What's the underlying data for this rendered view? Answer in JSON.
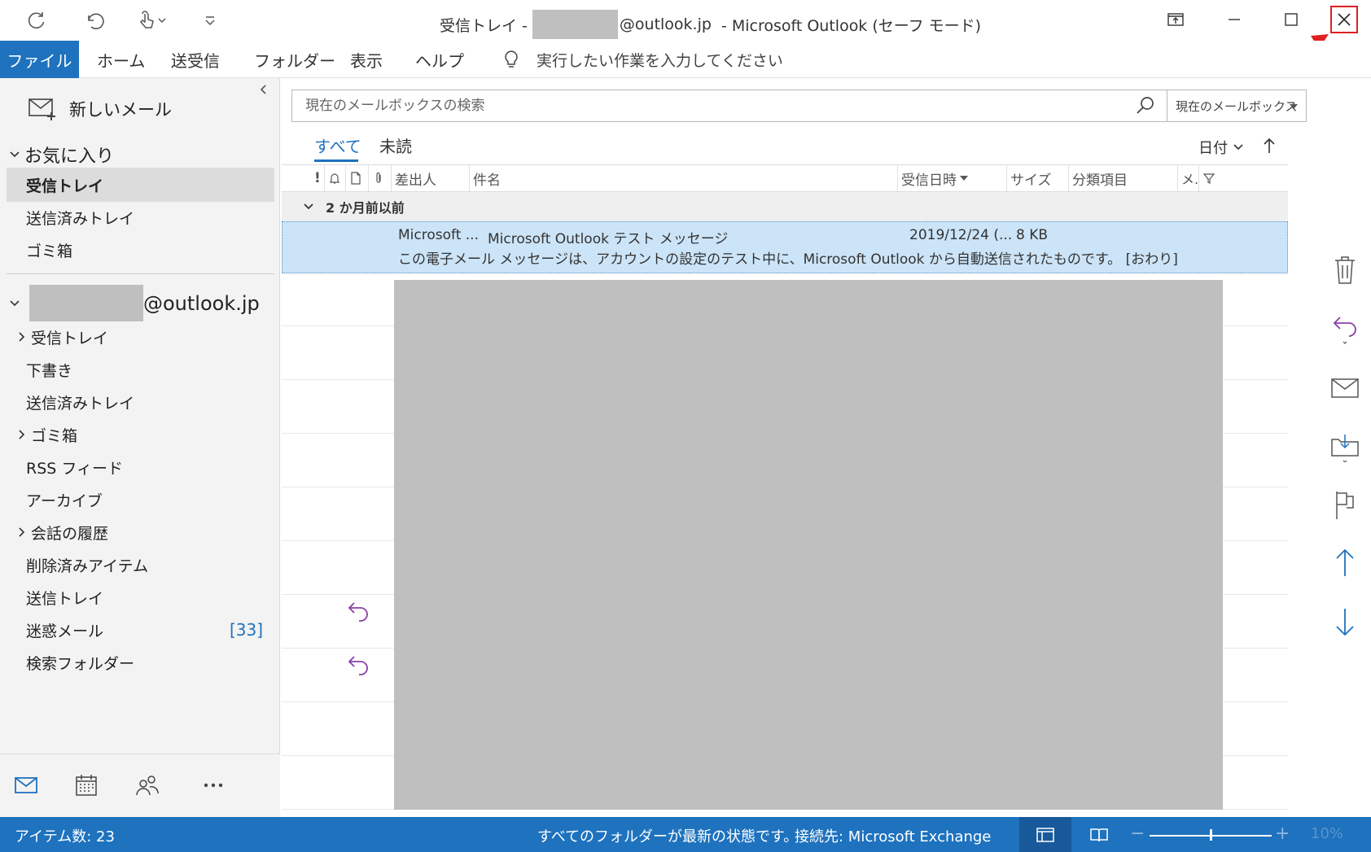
{
  "titlebar": {
    "title_prefix": "受信トレイ -",
    "title_domain": "@outlook.jp",
    "title_app": "-  Microsoft Outlook (セーフ モード)"
  },
  "ribbon": {
    "tabs": [
      "ファイル",
      "ホーム",
      "送受信",
      "フォルダー",
      "表示",
      "ヘルプ"
    ],
    "tell_me": "実行したい作業を入力してください"
  },
  "nav": {
    "new_mail": "新しいメール",
    "favorites_header": "お気に入り",
    "favorites": [
      "受信トレイ",
      "送信済みトレイ",
      "ゴミ箱"
    ],
    "account_domain": "@outlook.jp",
    "folders": [
      "受信トレイ",
      "下書き",
      "送信済みトレイ",
      "ゴミ箱",
      "RSS フィード",
      "アーカイブ",
      "会話の履歴",
      "削除済みアイテム",
      "送信トレイ",
      "迷惑メール",
      "検索フォルダー"
    ],
    "junk_count": "[33]"
  },
  "search": {
    "placeholder": "現在のメールボックスの検索",
    "scope": "現在のメールボックス"
  },
  "filter": {
    "all": "すべて",
    "unread": "未読",
    "sort_by": "日付"
  },
  "columns": {
    "importance": "!",
    "from": "差出人",
    "subject": "件名",
    "received": "受信日時",
    "size": "サイズ",
    "category": "分類項目",
    "mention": "メ.."
  },
  "group": {
    "label": "2 か月前以前"
  },
  "message": {
    "from": "Microsoft ...",
    "subject": "Microsoft Outlook テスト メッセージ",
    "received": "2019/12/24 (...",
    "size": "8 KB",
    "preview": "この電子メール メッセージは、アカウントの設定のテスト中に、Microsoft Outlook から自動送信されたものです。 [おわり]"
  },
  "status": {
    "items": "アイテム数: 23",
    "sync": "すべてのフォルダーが最新の状態です。",
    "connection": "接続先: Microsoft Exchange",
    "zoom_minus": "−",
    "zoom_plus": "+",
    "zoom": "10%",
    "zoom_fraction": 0.5
  },
  "colors": {
    "accent": "#1e72be",
    "selected_row": "#cce4f7",
    "redaction": "#bfbfbf",
    "reply_icon": "#8b3fa8",
    "highlight": "#e02020"
  }
}
